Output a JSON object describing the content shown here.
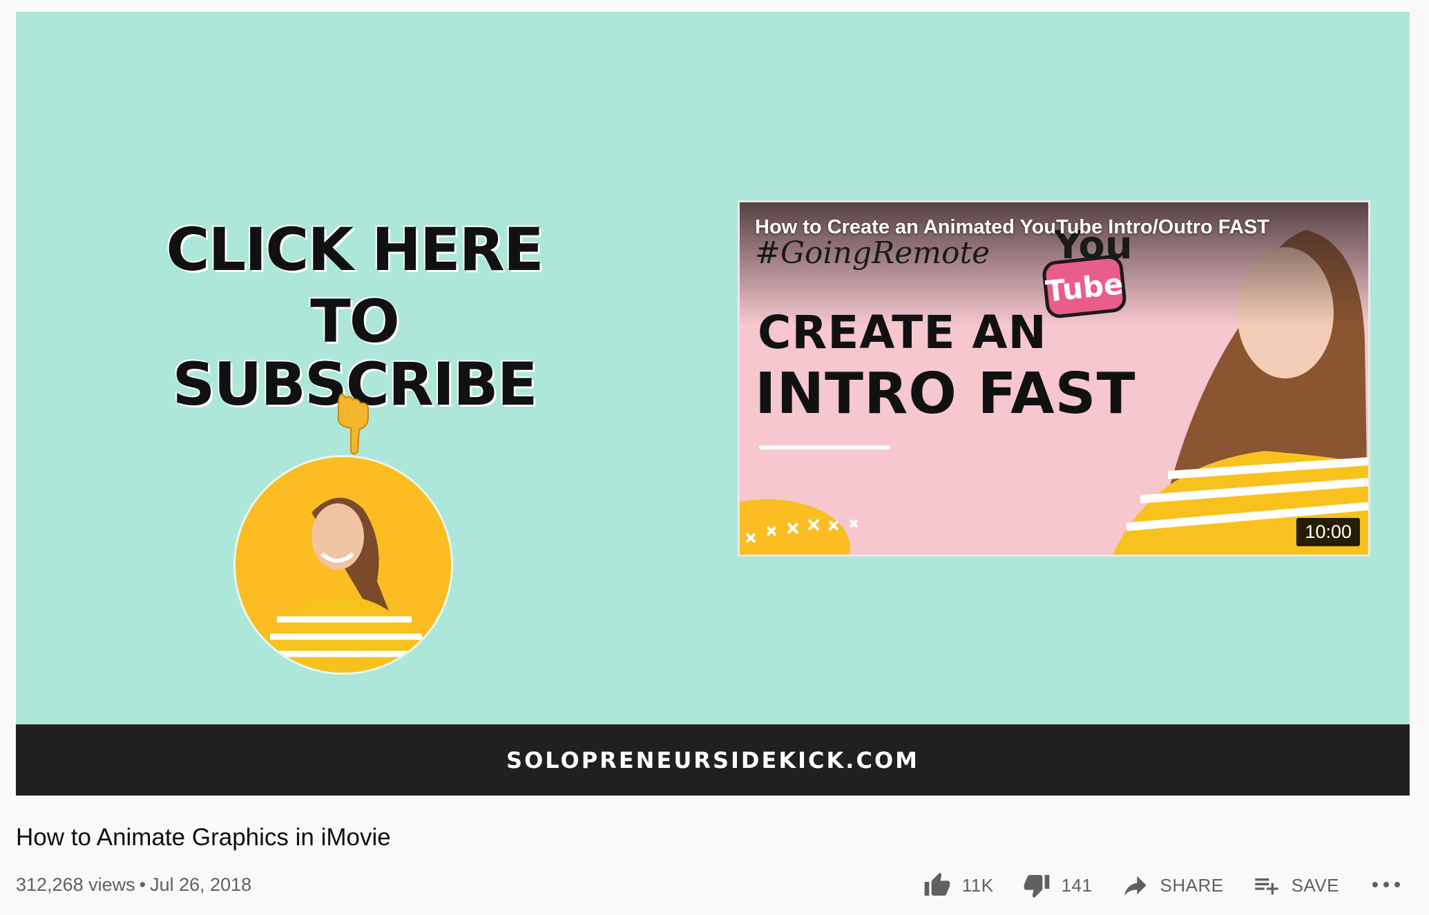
{
  "player": {
    "endscreen": {
      "cta_line1": "CLICK HERE",
      "cta_line2": "TO SUBSCRIBE",
      "site_url": "SOLOPRENEURSIDEKICK.COM"
    },
    "card": {
      "title": "How to Create an Animated YouTube Intro/Outro FAST",
      "hashtag": "#GoingRemote",
      "badge_top": "You",
      "badge_text": "Tube",
      "headline1": "CREATE AN",
      "headline2": "INTRO FAST",
      "duration": "10:00"
    }
  },
  "video": {
    "title": "How to Animate Graphics in iMovie",
    "views": "312,268 views",
    "separator": "•",
    "date": "Jul 26, 2018"
  },
  "actions": {
    "like_count": "11K",
    "dislike_count": "141",
    "share_label": "SHARE",
    "save_label": "SAVE"
  },
  "colors": {
    "player_bg": "#ade7d9",
    "bar_bg": "#202020",
    "accent_yellow": "#fbbd21",
    "card_pink": "#f6c7cf",
    "badge_pink": "#e95d8a"
  }
}
